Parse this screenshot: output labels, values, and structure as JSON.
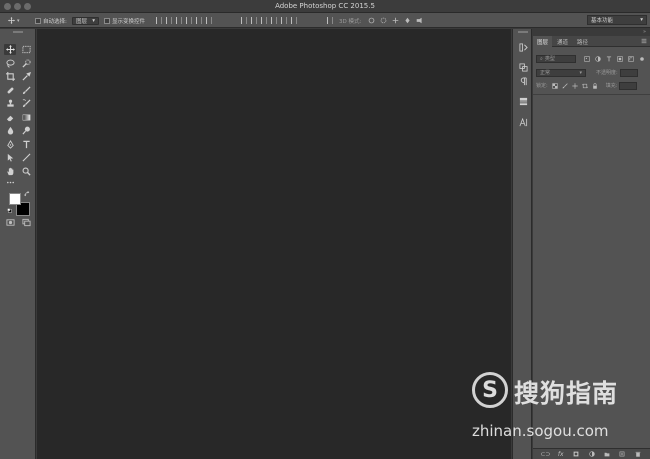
{
  "window": {
    "title": "Adobe Photoshop CC 2015.5"
  },
  "options_bar": {
    "auto_select_label": "自动选择:",
    "auto_select_value": "图层",
    "show_transform_label": "显示变换控件",
    "mode_3d_label": "3D 模式:"
  },
  "workspace": {
    "value": "基本功能"
  },
  "panel": {
    "tabs": [
      "图层",
      "通道",
      "路径"
    ],
    "filter_placeholder": "类型",
    "blend_mode": "正常",
    "opacity_label": "不透明度:",
    "lock_label": "锁定:",
    "fill_label": "填充:"
  },
  "watermark": {
    "brand": "搜狗指南",
    "url": "zhinan.sogou.com",
    "logo_letter": "S"
  },
  "colors": {
    "chrome": "#535353",
    "canvas": "#282828",
    "titlebar": "#3c3c3c",
    "foreground_swatch": "#ffffff",
    "background_swatch": "#000000"
  }
}
